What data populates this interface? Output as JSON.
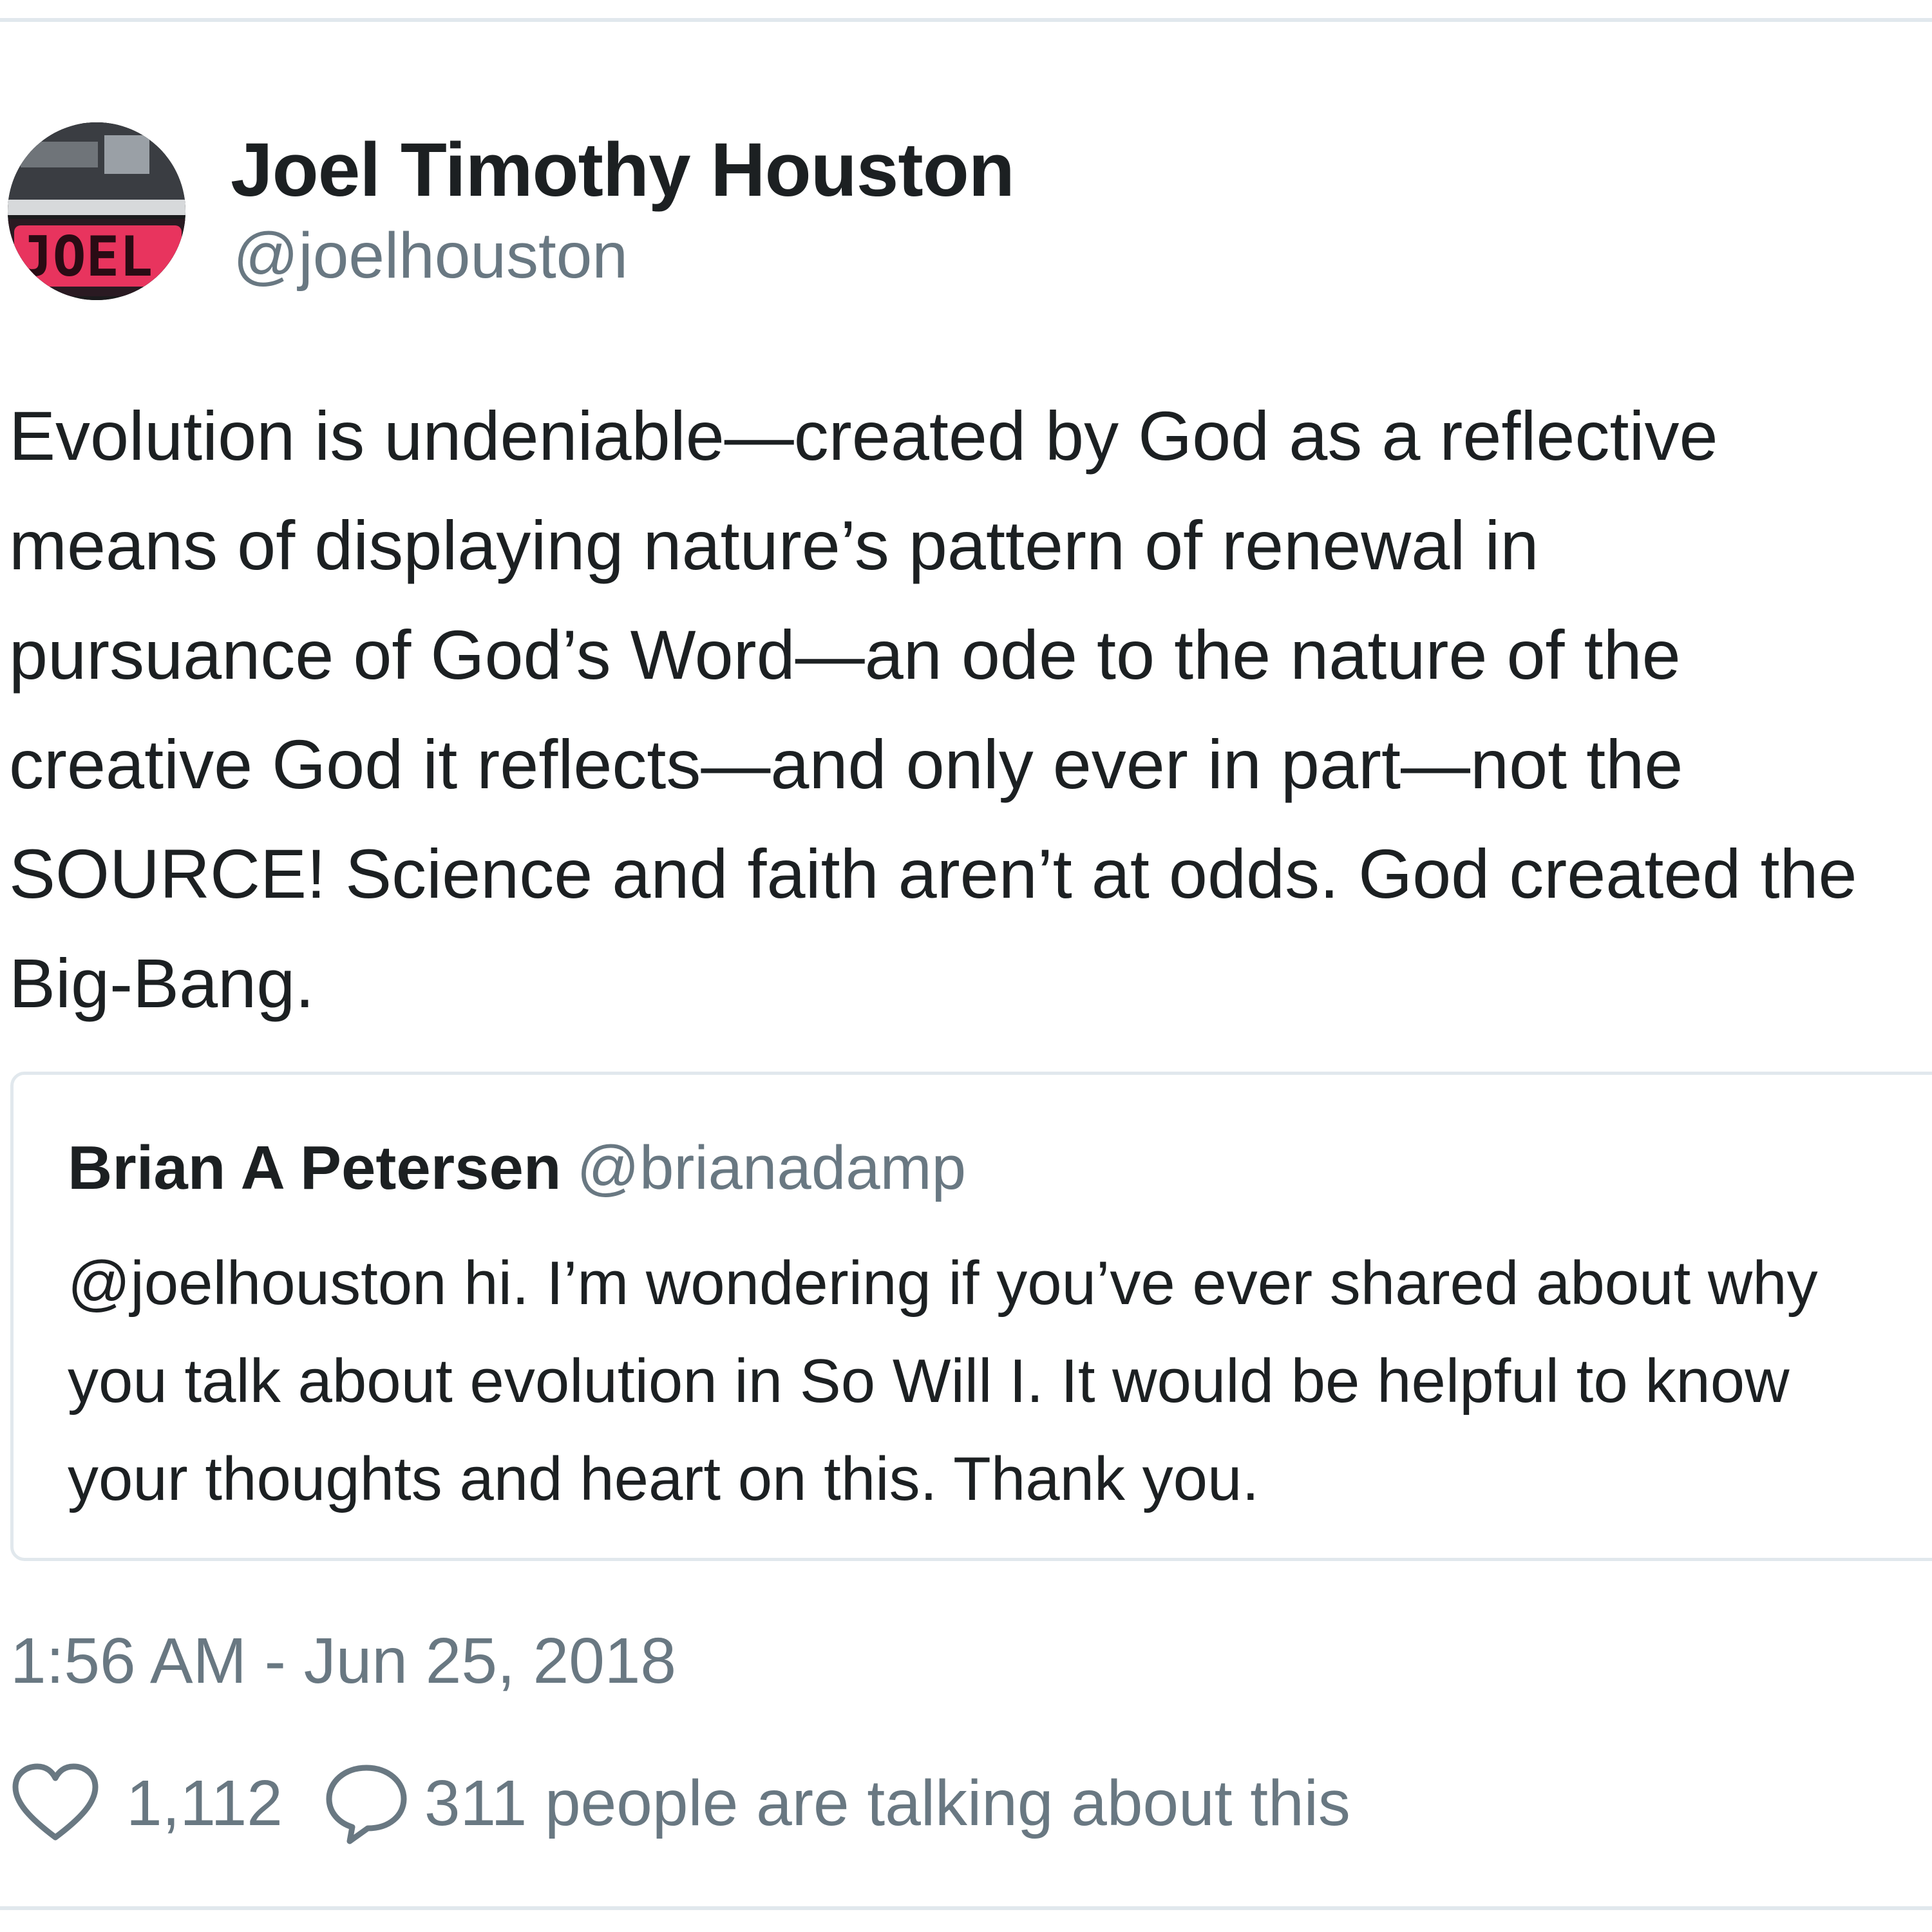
{
  "tweet": {
    "author": {
      "name": "Joel Timothy Houston",
      "handle": "@joelhouston",
      "avatar_text": "JOEL"
    },
    "text_lines": [
      "Evolution is undeniable—created by God as a reflective",
      "means of displaying nature’s pattern of renewal in",
      "pursuance of God’s Word—an ode to the nature of the",
      "creative God it reflects—and only ever in part—not the",
      "SOURCE! Science and faith aren’t at odds. God created the",
      "Big-Bang."
    ],
    "quoted": {
      "name": "Brian A Petersen",
      "handle": "@brianadamp",
      "text_lines": [
        "@joelhouston hi. I’m wondering if you’ve ever shared about why",
        "you talk about evolution in So Will I. It would be helpful to know",
        "your thoughts and heart on this. Thank you."
      ]
    },
    "timestamp": "1:56 AM - Jun 25, 2018",
    "likes": "1,112",
    "talking": "311 people are talking about this",
    "icons": {
      "like": "heart-icon",
      "reply": "speech-bubble-icon"
    },
    "colors": {
      "text": "#1c2022",
      "secondary": "#697882",
      "border": "#e1e8ed",
      "avatar_accent": "#e8345e"
    }
  }
}
